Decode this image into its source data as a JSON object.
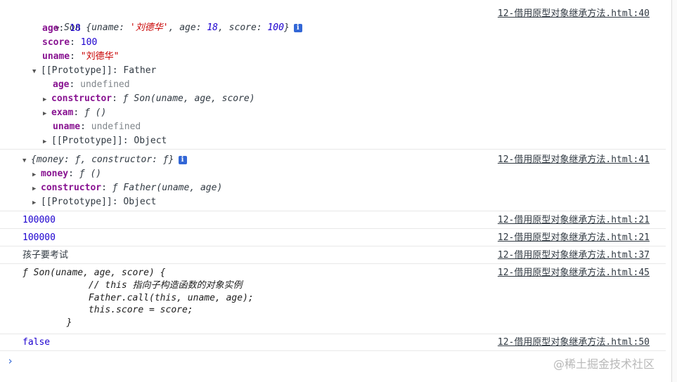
{
  "messages": {
    "son_obj": {
      "summary_name": "Son",
      "summary_open": " {",
      "summary_k1": "uname",
      "summary_v1": "'刘德华'",
      "summary_k2": "age",
      "summary_v2": "18",
      "summary_k3": "score",
      "summary_v3": "100",
      "summary_close": "}",
      "age_key": "age",
      "age_val": "18",
      "score_key": "score",
      "score_val": "100",
      "uname_key": "uname",
      "uname_val": "\"刘德华\"",
      "proto_key": "[[Prototype]]",
      "proto_val": "Father",
      "p_age_key": "age",
      "p_age_val": "undefined",
      "p_ctor_key": "constructor",
      "p_ctor_val": "ƒ Son(uname, age, score)",
      "p_exam_key": "exam",
      "p_exam_val": "ƒ ()",
      "p_uname_key": "uname",
      "p_uname_val": "undefined",
      "p_proto_key": "[[Prototype]]",
      "p_proto_val": "Object",
      "source": "12-借用原型对象继承方法.html:40"
    },
    "father_proto": {
      "summary": "{money: ƒ, constructor: ƒ}",
      "money_key": "money",
      "money_val": "ƒ ()",
      "ctor_key": "constructor",
      "ctor_val": "ƒ Father(uname, age)",
      "proto_key": "[[Prototype]]",
      "proto_val": "Object",
      "source": "12-借用原型对象继承方法.html:41"
    },
    "log1": {
      "text": "100000",
      "source": "12-借用原型对象继承方法.html:21"
    },
    "log2": {
      "text": "100000",
      "source": "12-借用原型对象继承方法.html:21"
    },
    "log3": {
      "text": "孩子要考试",
      "source": "12-借用原型对象继承方法.html:37"
    },
    "func": {
      "line1": "ƒ Son(uname, age, score) {",
      "line2": "            // this 指向子构造函数的对象实例",
      "line3": "            Father.call(this, uname, age);",
      "line4": "            this.score = score;",
      "line5": "        }",
      "source": "12-借用原型对象继承方法.html:45"
    },
    "log4": {
      "text": "false",
      "source": "12-借用原型对象继承方法.html:50"
    }
  },
  "prompt_symbol": "›",
  "watermark": "@稀土掘金技术社区"
}
